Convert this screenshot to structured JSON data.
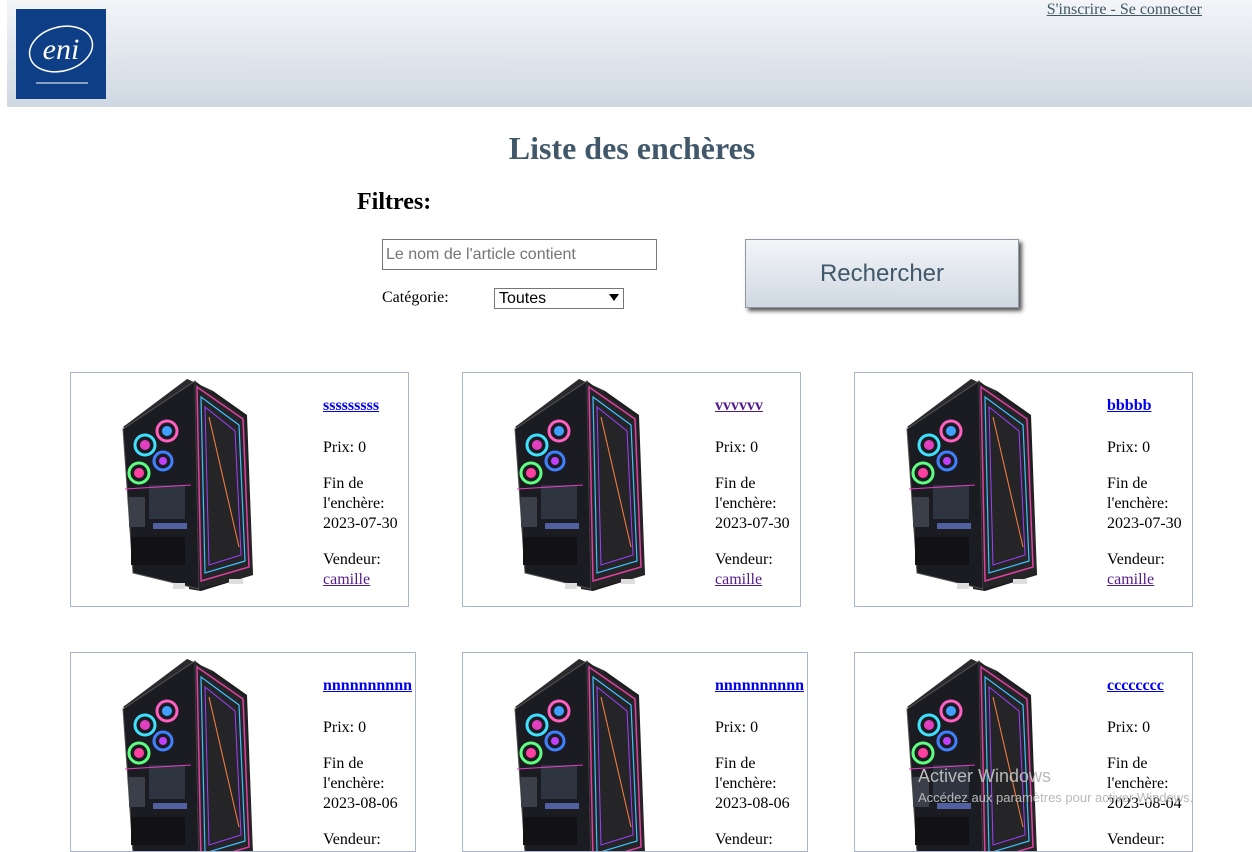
{
  "header": {
    "logo_text": "eni",
    "auth_link": "S'inscrire - Se connecter"
  },
  "page_title": "Liste des enchères",
  "filters": {
    "title": "Filtres:",
    "search_placeholder": "Le nom de l'article contient",
    "category_label": "Catégorie:",
    "category_selected": "Toutes",
    "search_button": "Rechercher"
  },
  "auctions": [
    {
      "name": "sssssssss",
      "price": "Prix: 0",
      "end_label": "Fin de l'enchère:",
      "end_date": "2023-07-30",
      "seller_label": "Vendeur:",
      "seller": "camille"
    },
    {
      "name": "vvvvvv",
      "price": "Prix: 0",
      "end_label": "Fin de l'enchère:",
      "end_date": "2023-07-30",
      "seller_label": "Vendeur:",
      "seller": "camille"
    },
    {
      "name": "bbbbb",
      "price": "Prix: 0",
      "end_label": "Fin de l'enchère:",
      "end_date": "2023-07-30",
      "seller_label": "Vendeur:",
      "seller": "camille"
    },
    {
      "name": "nnnnnnnnnn",
      "price": "Prix: 0",
      "end_label": "Fin de l'enchère:",
      "end_date": "2023-08-06",
      "seller_label": "Vendeur:",
      "seller": ""
    },
    {
      "name": "nnnnnnnnnn",
      "price": "Prix: 0",
      "end_label": "Fin de l'enchère:",
      "end_date": "2023-08-06",
      "seller_label": "Vendeur:",
      "seller": ""
    },
    {
      "name": "cccccccc",
      "price": "Prix: 0",
      "end_label": "Fin de l'enchère:",
      "end_date": "2023-08-04",
      "seller_label": "Vendeur:",
      "seller": ""
    }
  ],
  "watermark": {
    "line1": "Activer Windows",
    "line2": "Accédez aux paramètres pour activer Windows."
  },
  "colors": {
    "logo_bg": "#0e3f86",
    "title": "#40586a",
    "link": "#0000ee",
    "visited_link": "#551a8b",
    "card_border": "#a8b4cc"
  },
  "icons": {
    "product_image": "gaming-pc-tower-icon"
  }
}
